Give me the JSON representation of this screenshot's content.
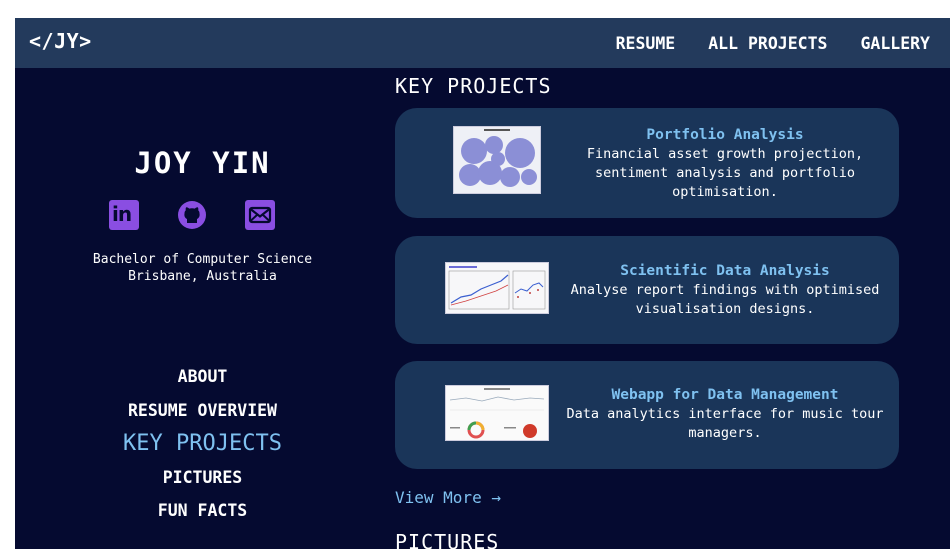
{
  "header": {
    "logo": "</JY>",
    "nav": [
      "RESUME",
      "ALL PROJECTS",
      "GALLERY"
    ]
  },
  "profile": {
    "name": "JOY YIN",
    "degree": "Bachelor of Computer Science",
    "location": "Brisbane, Australia",
    "socials": [
      "linkedin-icon",
      "github-icon",
      "email-icon"
    ]
  },
  "menu": {
    "items": [
      "ABOUT",
      "RESUME OVERVIEW",
      "KEY PROJECTS",
      "PICTURES",
      "FUN FACTS"
    ],
    "active": "KEY PROJECTS"
  },
  "sections": {
    "key_projects": "KEY PROJECTS",
    "pictures": "PICTURES"
  },
  "projects": [
    {
      "title": "Portfolio Analysis",
      "description": "Financial asset growth projection, sentiment analysis and portfolio optimisation."
    },
    {
      "title": "Scientific Data Analysis",
      "description": "Analyse report findings with optimised visualisation designs."
    },
    {
      "title": "Webapp for Data Management",
      "description": "Data analytics interface for music tour managers."
    }
  ],
  "view_more": "View More →",
  "colors": {
    "background": "#050a30",
    "header": "#233a5c",
    "card": "#1a3559",
    "accent": "#7fc1f0",
    "social": "#8a4ee2"
  }
}
